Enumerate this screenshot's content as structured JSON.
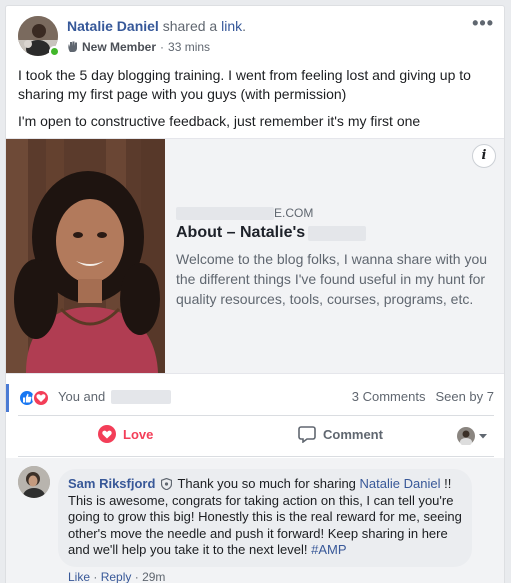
{
  "post": {
    "author": "Natalie Daniel",
    "action_prefix": "shared a",
    "action_link": "link",
    "action_suffix": ".",
    "badge": "New Member",
    "separator": "·",
    "time": "33 mins",
    "more": "•••",
    "text_p1": "I took the 5 day blogging training. I went from feeling lost and giving up to sharing my first page with you guys (with permission)",
    "text_p2": "I'm open to constructive feedback, just remember it's my first one"
  },
  "link_preview": {
    "domain_suffix": "E.COM",
    "title": "About – Natalie's",
    "description": "Welcome to the blog folks, I wanna share with you the different things I've found useful in my hunt for quality resources, tools, courses, programs, etc.",
    "info_label": "i"
  },
  "reactions": {
    "who_prefix": "You and",
    "comments_count": "3 Comments",
    "seen_by": "Seen by 7"
  },
  "actions": {
    "love_label": "Love",
    "comment_label": "Comment"
  },
  "comment": {
    "author": "Sam Riksfjord",
    "text_1": "Thank you so much for sharing",
    "mention": "Natalie Daniel",
    "text_2": "!! This is awesome, congrats for taking action on this, I can tell you're going to grow this big! Honestly this is the real reward for me, seeing other's move the needle and push it forward! Keep sharing in here and we'll help you take it to the next level!",
    "hashtag": "#AMP",
    "like_label": "Like",
    "reply_label": "Reply",
    "separator": "·",
    "time": "29m"
  },
  "colors": {
    "link_blue": "#365899",
    "love_red": "#f33e58",
    "like_blue": "#1877f2",
    "online_green": "#42b72a"
  }
}
